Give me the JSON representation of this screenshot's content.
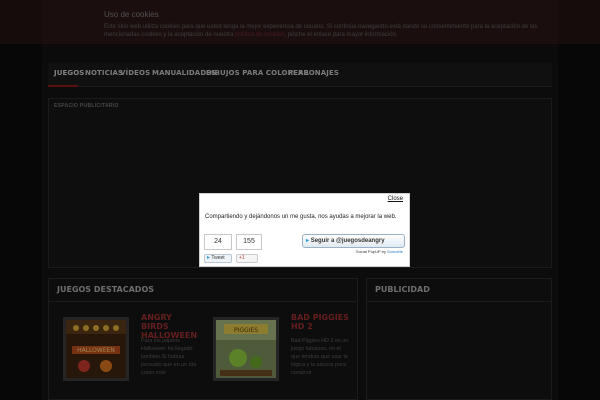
{
  "cookie": {
    "title": "Uso de cookies",
    "text": "Este sitio web utiliza cookies para que usted tenga la mejor experiencia de usuario. Si continúa navegando está dando su consentimiento para la aceptación de las mencionadas cookies y la aceptación de nuestra",
    "link": "política de cookies",
    "text_end": ", pinche el enlace para mayor información."
  },
  "nav": {
    "items": [
      {
        "label": "JUEGOS"
      },
      {
        "label": "NOTICIAS"
      },
      {
        "label": "VÍDEOS"
      },
      {
        "label": "MANUALIDADES"
      },
      {
        "label": "DIBUJOS PARA COLOREAR"
      },
      {
        "label": "PERSONAJES"
      }
    ]
  },
  "ad": {
    "label": "ESPACIO PUBLICITARIO"
  },
  "featured": {
    "title": "JUEGOS DESTACADOS",
    "games": [
      {
        "title": "ANGRY BIRDS HALLOWEEN",
        "desc": "Para los pájaros Halloween ha llegado también.Si habías pensado que en un día como este"
      },
      {
        "title": "BAD PIGGIES HD 2",
        "desc": "Bad Piggies HD 2 es un juego fabuloso, en el que tendrás que usar la lógica y la astucia para construir"
      }
    ]
  },
  "sidebar": {
    "title": "PUBLICIDAD"
  },
  "popup": {
    "close": "Close",
    "message": "Compartiendo y dejándonos un me gusta, nos ayudas a mejorar la web.",
    "tweet_count": "24",
    "gplus_count": "155",
    "tweet_label": "Tweet",
    "gplus_label": "+1",
    "follow_label": "Seguir a @juegosdeangry",
    "credit_prefix": "Social PopUP by",
    "credit_brand": "SumoMe"
  },
  "colors": {
    "accent": "#8b1a1a",
    "twitter": "#2b9cd8"
  }
}
